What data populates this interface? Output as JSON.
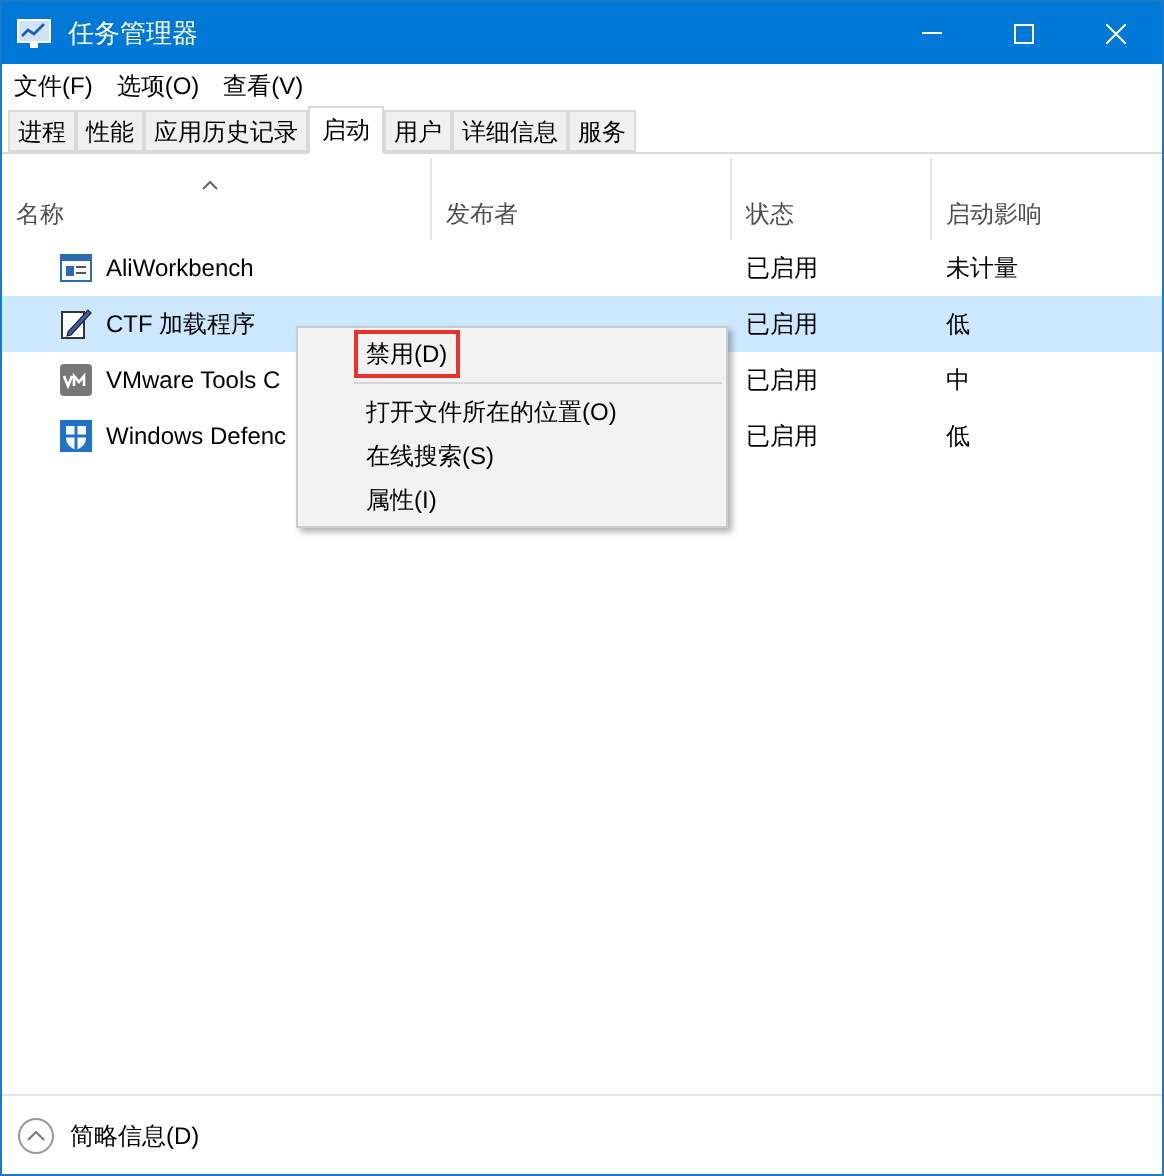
{
  "window": {
    "title": "任务管理器"
  },
  "menu_bar": [
    "文件(F)",
    "选项(O)",
    "查看(V)"
  ],
  "tabs": [
    {
      "label": "进程",
      "selected": false
    },
    {
      "label": "性能",
      "selected": false
    },
    {
      "label": "应用历史记录",
      "selected": false
    },
    {
      "label": "启动",
      "selected": true
    },
    {
      "label": "用户",
      "selected": false
    },
    {
      "label": "详细信息",
      "selected": false
    },
    {
      "label": "服务",
      "selected": false
    }
  ],
  "table": {
    "columns": [
      {
        "label": "名称",
        "sorted": true
      },
      {
        "label": "发布者",
        "sorted": false
      },
      {
        "label": "状态",
        "sorted": false
      },
      {
        "label": "启动影响",
        "sorted": false
      }
    ],
    "rows": [
      {
        "kind": "window",
        "name": "AliWorkbench",
        "status": "已启用",
        "impact": "未计量",
        "selected": false
      },
      {
        "kind": "pen",
        "name": "CTF 加载程序",
        "status": "已启用",
        "impact": "低",
        "selected": true
      },
      {
        "kind": "vm",
        "name": "VMware Tools C",
        "status": "已启用",
        "impact": "中",
        "selected": false
      },
      {
        "kind": "shield",
        "name": "Windows Defenc",
        "status": "已启用",
        "impact": "低",
        "selected": false
      }
    ]
  },
  "context_menu": [
    {
      "label": "禁用(D)",
      "outlined": true,
      "separator_after": true
    },
    {
      "label": "打开文件所在的位置(O)",
      "outlined": false,
      "separator_after": false
    },
    {
      "label": "在线搜索(S)",
      "outlined": false,
      "separator_after": false
    },
    {
      "label": "属性(I)",
      "outlined": false,
      "separator_after": false
    }
  ],
  "footer": {
    "label": "简略信息(D)"
  }
}
